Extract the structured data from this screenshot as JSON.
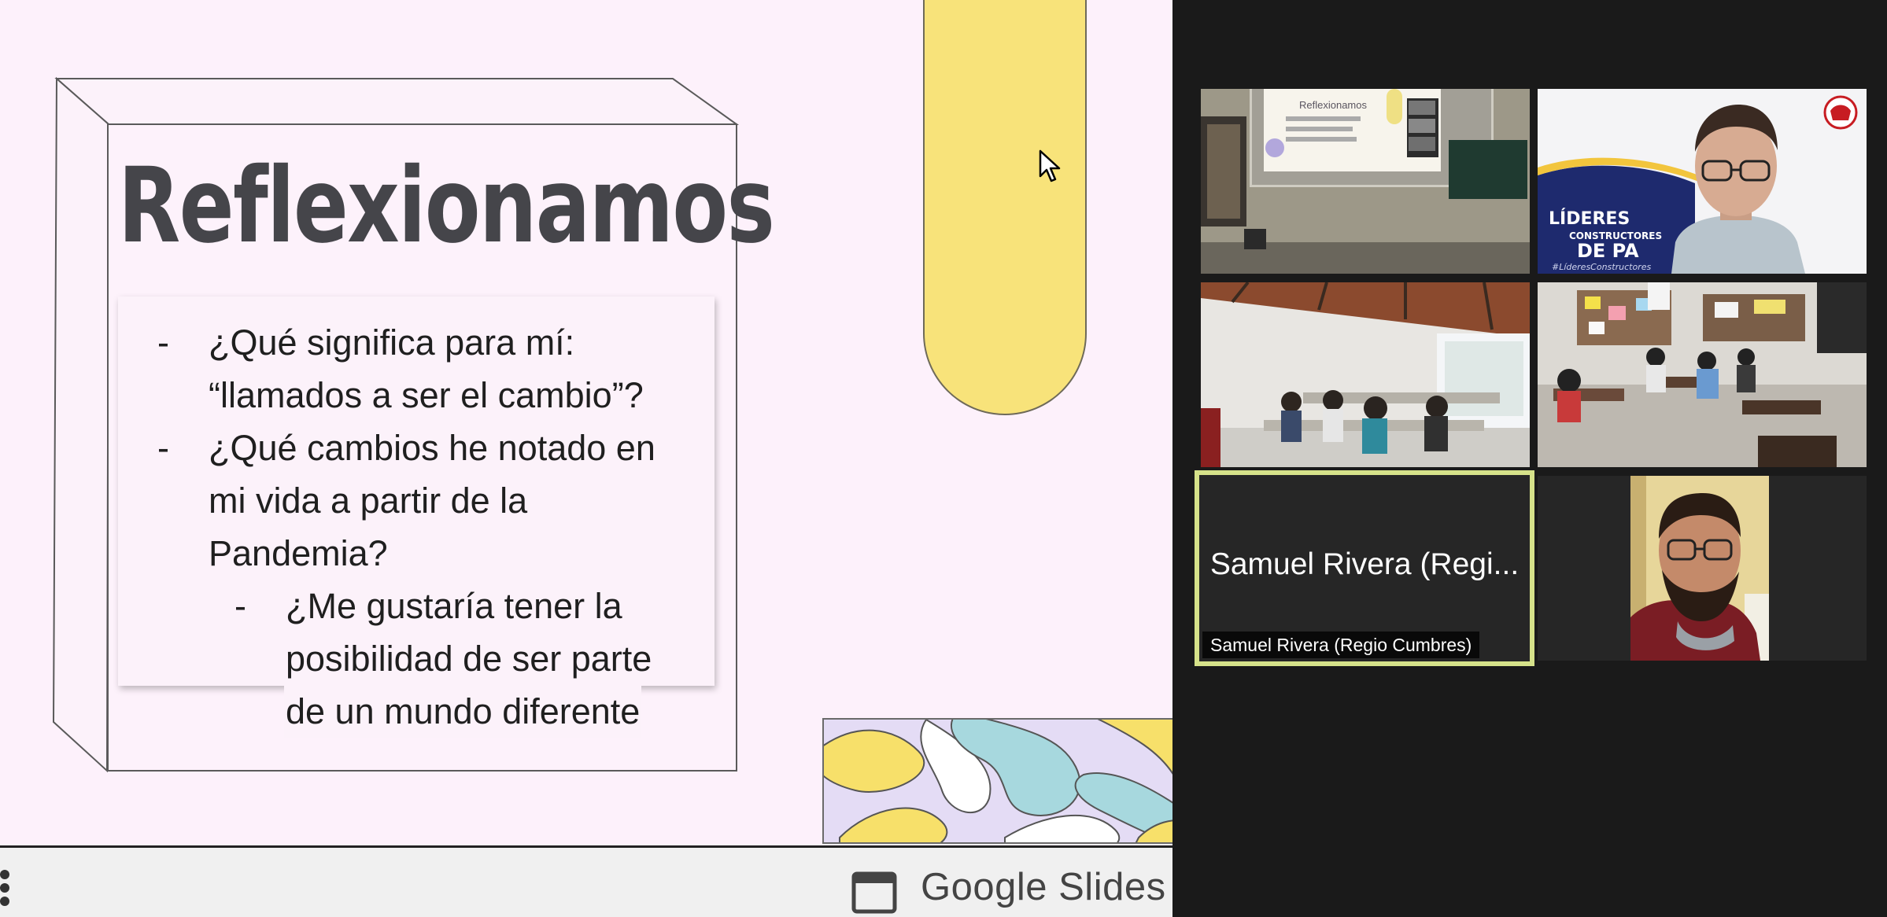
{
  "slide": {
    "title": "Reflexionamos",
    "bullets": [
      {
        "level": 1,
        "lines": [
          "¿Qué significa para mí:",
          "“llamados a ser el cambio”?"
        ]
      },
      {
        "level": 1,
        "lines": [
          "¿Qué cambios he notado en",
          "mi vida a partir de la",
          "Pandemia?"
        ]
      },
      {
        "level": 2,
        "lines": [
          "¿Me gustaría tener la",
          "posibilidad de ser parte",
          "de un mundo diferente"
        ]
      }
    ],
    "dash": "-"
  },
  "slides_bar": {
    "app_label": "Google Slides"
  },
  "gallery": {
    "tiles": [
      {
        "id": "classroom-projector",
        "kind": "video"
      },
      {
        "id": "teacher-1",
        "kind": "video",
        "background_text": {
          "line1": "LÍDERES",
          "line2": "CONSTRUCTORES",
          "line3": "DE PA",
          "line4": "#LíderesConstructores"
        }
      },
      {
        "id": "classroom-2",
        "kind": "video"
      },
      {
        "id": "classroom-3",
        "kind": "video"
      },
      {
        "id": "samuel",
        "kind": "avatar",
        "display_name": "Samuel Rivera (Regi...",
        "name_tag": "Samuel Rivera (Regio Cumbres)",
        "active_speaker_color": "#d6e28a"
      },
      {
        "id": "teacher-2",
        "kind": "video"
      }
    ],
    "projector_slide_title": "Reflexionamos"
  },
  "colors": {
    "slide_bg": "#fdf1fb",
    "title": "#45454a",
    "pill": "#f8e37a",
    "gallery_bg": "#1a1a1a",
    "speaker_border": "#d6e28a"
  }
}
